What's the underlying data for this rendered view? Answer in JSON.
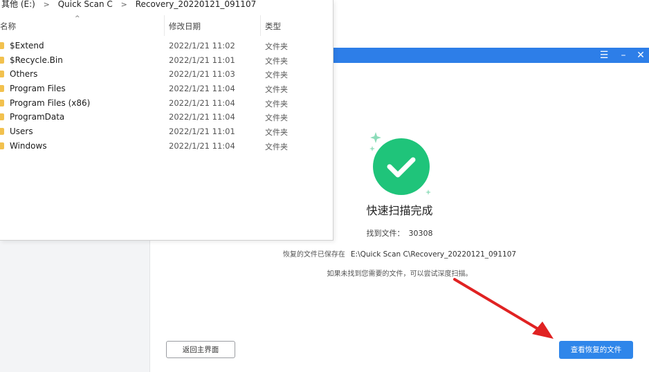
{
  "explorer": {
    "breadcrumb": [
      "其他 (E:)",
      "Quick Scan C",
      "Recovery_20220121_091107"
    ],
    "columns": {
      "name": "名称",
      "date": "修改日期",
      "type": "类型"
    },
    "rows": [
      {
        "name": "$Extend",
        "date": "2022/1/21 11:02",
        "type": "文件夹"
      },
      {
        "name": "$Recycle.Bin",
        "date": "2022/1/21 11:01",
        "type": "文件夹"
      },
      {
        "name": "Others",
        "date": "2022/1/21 11:03",
        "type": "文件夹"
      },
      {
        "name": "Program Files",
        "date": "2022/1/21 11:04",
        "type": "文件夹"
      },
      {
        "name": "Program Files (x86)",
        "date": "2022/1/21 11:04",
        "type": "文件夹"
      },
      {
        "name": "ProgramData",
        "date": "2022/1/21 11:04",
        "type": "文件夹"
      },
      {
        "name": "Users",
        "date": "2022/1/21 11:01",
        "type": "文件夹"
      },
      {
        "name": "Windows",
        "date": "2022/1/21 11:04",
        "type": "文件夹"
      }
    ]
  },
  "app": {
    "titlebar_color": "#2d7ee8",
    "controls": {
      "menu": "☰",
      "minimize": "–",
      "close": "✕"
    },
    "status_icon": "check-circle-icon",
    "status_color": "#1fc47a",
    "title": "快速扫描完成",
    "found_label": "找到文件：",
    "found_count": "30308",
    "saved_label": "恢复的文件已保存在",
    "saved_path": "E:\\Quick Scan C\\Recovery_20220121_091107",
    "hint": "如果未找到您需要的文件，可以尝试深度扫描。",
    "back_button": "返回主界面",
    "view_button": "查看恢复的文件"
  }
}
